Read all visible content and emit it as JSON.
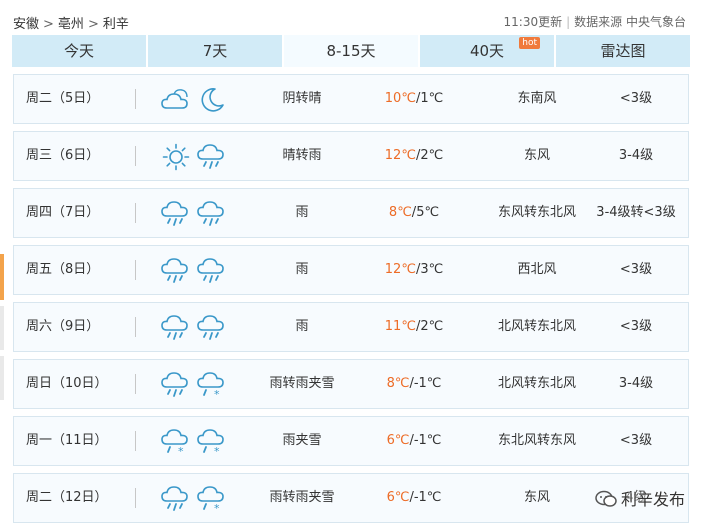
{
  "breadcrumb": [
    "安徽",
    "亳州",
    "利辛"
  ],
  "breadcrumb_separator": ">",
  "meta": {
    "update_time": "11:30更新",
    "source": "数据来源 中央气象台"
  },
  "tabs": [
    {
      "label": "今天",
      "active": false
    },
    {
      "label": "7天",
      "active": false
    },
    {
      "label": "8-15天",
      "active": true
    },
    {
      "label": "40天",
      "active": false,
      "badge": "hot"
    },
    {
      "label": "雷达图",
      "active": false
    }
  ],
  "colors": {
    "accent_temp": "#ed6c27",
    "tab_bg": "#d2ebf7",
    "row_bg": "#f7fbfe",
    "icon": "#3a98c9"
  },
  "forecast": [
    {
      "day": "周二（5日）",
      "icons": [
        "cloudy-icon",
        "moon-icon"
      ],
      "desc": "阴转晴",
      "high": "10℃",
      "low": "1℃",
      "wind": "东南风",
      "level": "<3级"
    },
    {
      "day": "周三（6日）",
      "icons": [
        "sun-icon",
        "rain-cloud-icon"
      ],
      "desc": "晴转雨",
      "high": "12℃",
      "low": "2℃",
      "wind": "东风",
      "level": "3-4级"
    },
    {
      "day": "周四（7日）",
      "icons": [
        "rain-cloud-icon",
        "rain-cloud-icon"
      ],
      "desc": "雨",
      "high": "8℃",
      "low": "5℃",
      "wind": "东风转东北风",
      "level": "3-4级转<3级"
    },
    {
      "day": "周五（8日）",
      "icons": [
        "rain-cloud-icon",
        "rain-cloud-icon"
      ],
      "desc": "雨",
      "high": "12℃",
      "low": "3℃",
      "wind": "西北风",
      "level": "<3级"
    },
    {
      "day": "周六（9日）",
      "icons": [
        "rain-cloud-icon",
        "rain-cloud-icon"
      ],
      "desc": "雨",
      "high": "11℃",
      "low": "2℃",
      "wind": "北风转东北风",
      "level": "<3级"
    },
    {
      "day": "周日（10日）",
      "icons": [
        "rain-cloud-icon",
        "sleet-cloud-icon"
      ],
      "desc": "雨转雨夹雪",
      "high": "8℃",
      "low": "-1℃",
      "wind": "北风转东北风",
      "level": "3-4级"
    },
    {
      "day": "周一（11日）",
      "icons": [
        "sleet-cloud-icon",
        "sleet-cloud-icon"
      ],
      "desc": "雨夹雪",
      "high": "6℃",
      "low": "-1℃",
      "wind": "东北风转东风",
      "level": "<3级"
    },
    {
      "day": "周二（12日）",
      "icons": [
        "rain-cloud-icon",
        "sleet-cloud-icon"
      ],
      "desc": "雨转雨夹雪",
      "high": "6℃",
      "low": "-1℃",
      "wind": "东风",
      "level": "4级"
    }
  ],
  "watermark": "利辛发布"
}
